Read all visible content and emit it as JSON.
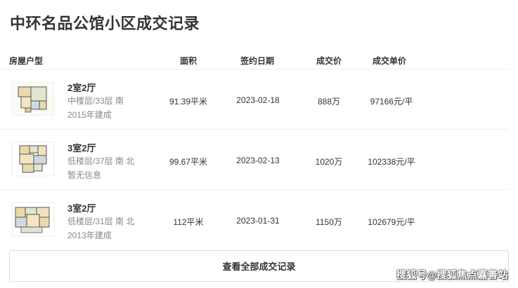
{
  "page": {
    "title": "中环名品公馆小区成交记录"
  },
  "table": {
    "headers": {
      "type": "房屋户型",
      "area": "面积",
      "date": "签约日期",
      "price": "成交价",
      "unit_price": "成交单价"
    },
    "rows": [
      {
        "room": "2室2厅",
        "floor": "中楼层/33层 南",
        "year": "2015年建成",
        "area": "91.39平米",
        "date": "2023-02-18",
        "price": "888万",
        "unit_price": "97166元/平"
      },
      {
        "room": "3室2厅",
        "floor": "低楼层/37层 南 北",
        "year": "暂无信息",
        "area": "99.67平米",
        "date": "2023-02-13",
        "price": "1020万",
        "unit_price": "102338元/平"
      },
      {
        "room": "3室2厅",
        "floor": "低楼层/31层 南 北",
        "year": "2013年建成",
        "area": "112平米",
        "date": "2023-01-31",
        "price": "1150万",
        "unit_price": "102679元/平"
      }
    ]
  },
  "more_button": {
    "label": "查看全部成交记录"
  },
  "watermark": {
    "text": "搜狐号@搜狐焦点嘉善站"
  }
}
